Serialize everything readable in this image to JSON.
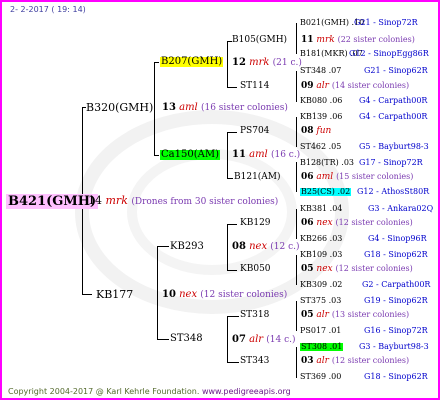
{
  "header": {
    "date": "2- 2-2017 ( 19: 14)"
  },
  "footer": {
    "copyright": "Copyright 2004-2017 @ Karl Kehrle Foundation.",
    "website": "www.pedigreeapis.org"
  },
  "queen": {
    "name": "B421(GMH)",
    "mating_num": "14",
    "mating_abbr": "mrk",
    "drone_note": "(Drones from 30 sister colonies)"
  },
  "gen1": [
    {
      "name": "B320(GMH)",
      "num": "13",
      "abbr": "aml",
      "note": "(16 sister colonies)"
    },
    {
      "name": "KB177",
      "num": "10",
      "abbr": "nex",
      "note": "(12 sister colonies)"
    }
  ],
  "gen2": [
    {
      "name": "B207(GMH)",
      "num": "12",
      "abbr": "mrk",
      "note": "(21 c.)",
      "hl": "yellow"
    },
    {
      "name": "Ca150(AM)",
      "num": "11",
      "abbr": "aml",
      "note": "(16 c.)",
      "hl": "green"
    },
    {
      "name": "KB293",
      "num": "08",
      "abbr": "nex",
      "note": "(12 c.)"
    },
    {
      "name": "ST348",
      "num": "07",
      "abbr": "alr",
      "note": "(14 c.)"
    }
  ],
  "gen3": [
    {
      "name": "B105(GMH)",
      "num": "11",
      "abbr": "mrk",
      "note": "(22 sister colonies)"
    },
    {
      "name": "ST114",
      "num": "09",
      "abbr": "alr",
      "note": "(14 sister colonies)"
    },
    {
      "name": "PS704",
      "num": "08",
      "abbr": "fun",
      "note": ""
    },
    {
      "name": "B121(AM)",
      "num": "06",
      "abbr": "aml",
      "note": "(15 sister colonies)"
    },
    {
      "name": "KB129",
      "num": "06",
      "abbr": "nex",
      "note": "(12 sister colonies)"
    },
    {
      "name": "KB050",
      "num": "05",
      "abbr": "nex",
      "note": "(12 sister colonies)"
    },
    {
      "name": "ST318",
      "num": "05",
      "abbr": "alr",
      "note": "(13 sister colonies)"
    },
    {
      "name": "ST343",
      "num": "03",
      "abbr": "alr",
      "note": "(12 sister colonies)"
    }
  ],
  "gen4": [
    {
      "name": "B021(GMH) .10",
      "loc": "G21 - Sinop72R"
    },
    {
      "name": "B181(MKR) .07",
      "loc": "G12 - SinopEgg86R"
    },
    {
      "name": "ST348 .07",
      "loc": "G21 - Sinop62R"
    },
    {
      "name": "KB080 .06",
      "loc": "G4 - Carpath00R"
    },
    {
      "name": "KB139 .06",
      "loc": "G4 - Carpath00R"
    },
    {
      "name": "ST462 .05",
      "loc": "G5 - Bayburt98-3"
    },
    {
      "name": "B128(TR) .03",
      "loc": "G17 - Sinop72R"
    },
    {
      "name": "B25(CS) .02",
      "loc": "G12 - AthosSt80R",
      "hl": "cyan"
    },
    {
      "name": "KB381 .04",
      "loc": "G3 - Ankara02Q"
    },
    {
      "name": "KB266 .03",
      "loc": "G4 - Sinop96R"
    },
    {
      "name": "KB109 .03",
      "loc": "G18 - Sinop62R"
    },
    {
      "name": "KB309 .02",
      "loc": "G2 - Carpath00R"
    },
    {
      "name": "ST375 .03",
      "loc": "G19 - Sinop62R"
    },
    {
      "name": "PS017 .01",
      "loc": "G16 - Sinop72R"
    },
    {
      "name": "ST308 .01",
      "loc": "G3 - Bayburt98-3",
      "hl": "green"
    },
    {
      "name": "ST369 .00",
      "loc": "G18 - Sinop62R"
    }
  ]
}
